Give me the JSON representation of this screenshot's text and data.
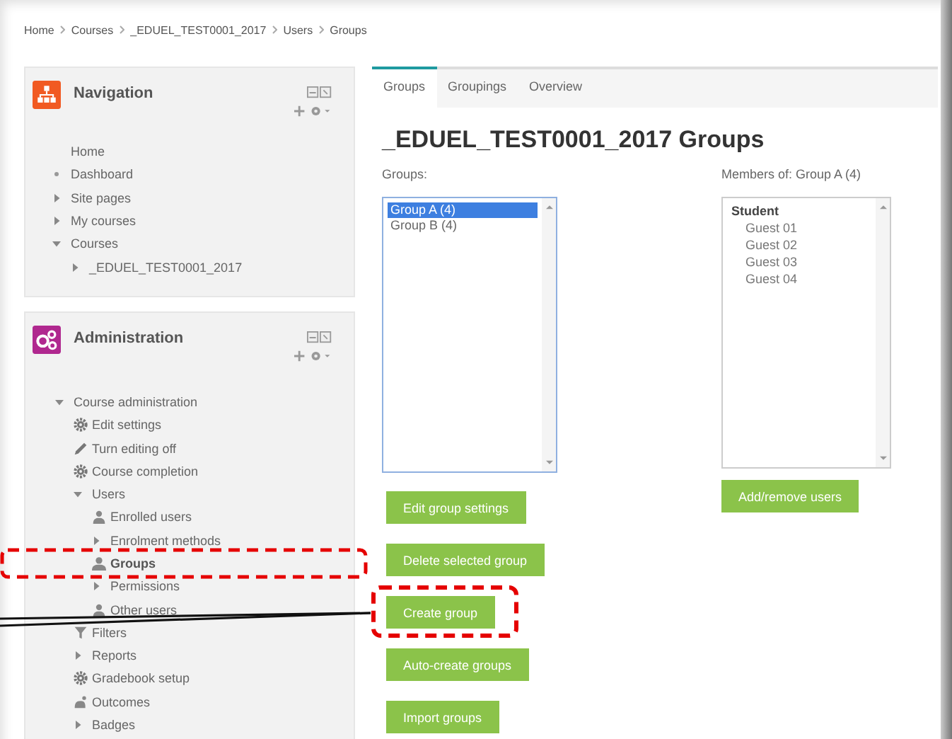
{
  "breadcrumb": [
    "Home",
    "Courses",
    "_EDUEL_TEST0001_2017",
    "Users",
    "Groups"
  ],
  "blocks": [
    {
      "kind": "navigation",
      "title": "Navigation",
      "items": [
        {
          "label": "Home",
          "kind": "text"
        },
        {
          "label": "Dashboard",
          "kind": "bullet"
        },
        {
          "label": "Site pages",
          "kind": "branch",
          "expanded": false
        },
        {
          "label": "My courses",
          "kind": "branch",
          "expanded": false
        },
        {
          "label": "Courses",
          "kind": "branch",
          "expanded": true,
          "children": [
            {
              "label": "_EDUEL_TEST0001_2017",
              "kind": "branch",
              "expanded": false
            }
          ]
        }
      ]
    },
    {
      "kind": "administration",
      "title": "Administration",
      "items": [
        {
          "label": "Course administration",
          "kind": "branch",
          "expanded": true,
          "children": [
            {
              "label": "Edit settings",
              "kind": "gear"
            },
            {
              "label": "Turn editing off",
              "kind": "pencil"
            },
            {
              "label": "Course completion",
              "kind": "gear"
            },
            {
              "label": "Users",
              "kind": "branch",
              "expanded": true,
              "children": [
                {
                  "label": "Enrolled users",
                  "kind": "person"
                },
                {
                  "label": "Enrolment methods",
                  "kind": "branch",
                  "expanded": false
                },
                {
                  "label": "Groups",
                  "kind": "group"
                },
                {
                  "label": "Permissions",
                  "kind": "branch",
                  "expanded": false
                },
                {
                  "label": "Other users",
                  "kind": "person"
                }
              ]
            },
            {
              "label": "Filters",
              "kind": "filter"
            },
            {
              "label": "Reports",
              "kind": "branch",
              "expanded": false
            },
            {
              "label": "Gradebook setup",
              "kind": "gear"
            },
            {
              "label": "Outcomes",
              "kind": "outcomes"
            },
            {
              "label": "Badges",
              "kind": "branch",
              "expanded": false
            }
          ]
        }
      ]
    }
  ],
  "tabs": [
    {
      "label": "Groups",
      "selected": true
    },
    {
      "label": "Groupings",
      "selected": false
    },
    {
      "label": "Overview",
      "selected": false
    }
  ],
  "heading": "_EDUEL_TEST0001_2017 Groups",
  "groups": {
    "label": "Groups:",
    "options": [
      {
        "label": "Group A (4)",
        "selected": true
      },
      {
        "label": "Group B (4)",
        "selected": false
      }
    ],
    "buttons": [
      "Edit group settings",
      "Delete selected group",
      "Create group",
      "Auto-create groups",
      "Import groups"
    ]
  },
  "members": {
    "label": "Members of: Group A (4)",
    "role": "Student",
    "names": [
      "Guest 01",
      "Guest 02",
      "Guest 03",
      "Guest 04"
    ],
    "button": "Add/remove users"
  }
}
